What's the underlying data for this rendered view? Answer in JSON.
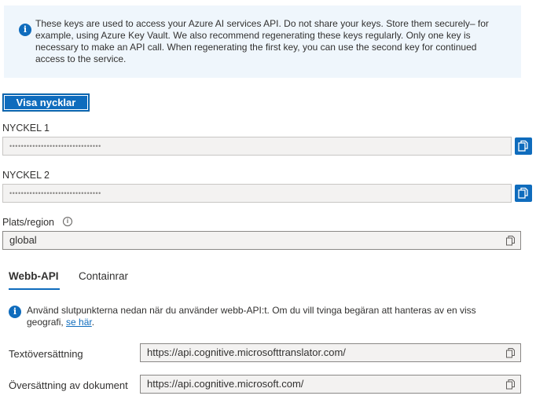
{
  "banner": {
    "icon": "info-icon",
    "text": "These keys are used to access your Azure AI services API. Do not share your keys. Store them securely– for example, using Azure Key Vault. We also recommend regenerating these keys regularly. Only one key is necessary to make an API call. When regenerating the first key, you can use the second key for continued access to the service."
  },
  "show_keys_button": "Visa nycklar",
  "key1": {
    "label": "NYCKEL 1",
    "value": "••••••••••••••••••••••••••••••••"
  },
  "key2": {
    "label": "NYCKEL 2",
    "value": "••••••••••••••••••••••••••••••••"
  },
  "region": {
    "label": "Plats/region",
    "value": "global"
  },
  "tabs": [
    {
      "label": "Webb-API",
      "active": true
    },
    {
      "label": "Containrar",
      "active": false
    }
  ],
  "api_info": {
    "text": "Använd slutpunkterna nedan när du använder webb-API:t. Om du vill tvinga begäran att hanteras av en viss geografi, ",
    "link": "se här",
    "suffix": "."
  },
  "endpoints": [
    {
      "label": "Textöversättning",
      "value": "https://api.cognitive.microsofttranslator.com/"
    },
    {
      "label": "Översättning av dokument",
      "value": "https://api.cognitive.microsoft.com/"
    }
  ],
  "colors": {
    "accent": "#0f6cbd",
    "banner_bg": "#eff6fc",
    "field_bg": "#f3f2f1"
  }
}
